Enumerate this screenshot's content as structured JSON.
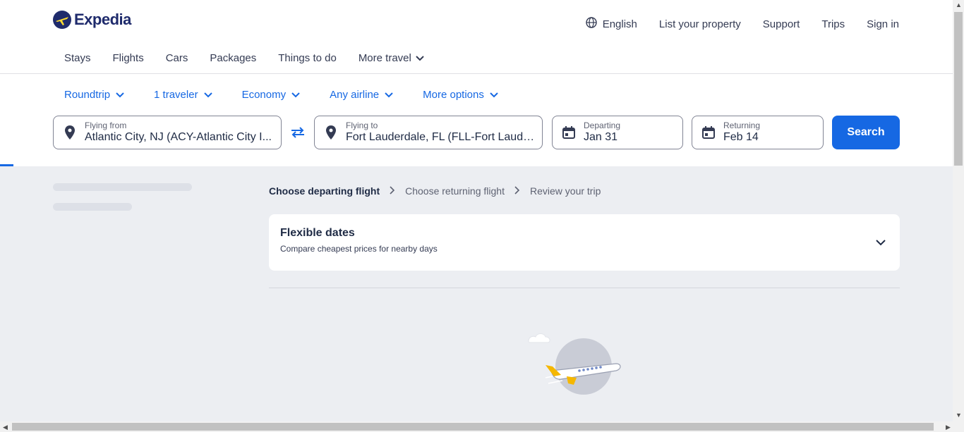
{
  "brand": {
    "name": "Expedia"
  },
  "header": {
    "language": "English",
    "links": [
      "List your property",
      "Support",
      "Trips",
      "Sign in"
    ]
  },
  "nav": {
    "items": [
      "Stays",
      "Flights",
      "Cars",
      "Packages",
      "Things to do"
    ],
    "more": "More travel"
  },
  "options": {
    "trip_type": "Roundtrip",
    "travelers": "1 traveler",
    "cabin": "Economy",
    "airline": "Any airline",
    "more": "More options"
  },
  "search": {
    "from_label": "Flying from",
    "from_value": "Atlantic City, NJ (ACY-Atlantic City I...",
    "to_label": "Flying to",
    "to_value": "Fort Lauderdale, FL (FLL-Fort Lauder...",
    "depart_label": "Departing",
    "depart_value": "Jan 31",
    "return_label": "Returning",
    "return_value": "Feb 14",
    "button": "Search"
  },
  "breadcrumb": {
    "step1": "Choose departing flight",
    "step2": "Choose returning flight",
    "step3": "Review your trip"
  },
  "flexible": {
    "title": "Flexible dates",
    "subtitle": "Compare cheapest prices for nearby days"
  },
  "colors": {
    "accent": "#1668e3",
    "brand_navy": "#1f2b6c",
    "background": "#eceef2",
    "plane_tail": "#f5b700"
  }
}
